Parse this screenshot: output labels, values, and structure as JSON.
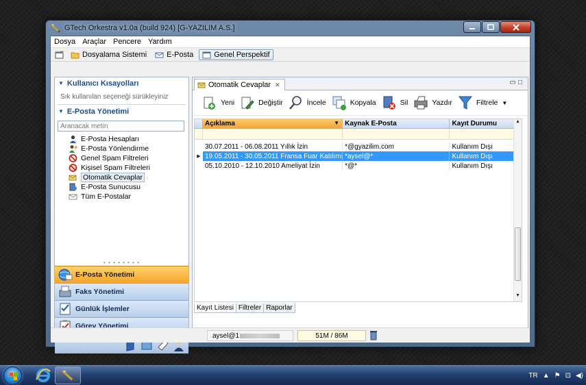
{
  "window": {
    "title": "GTech Orkestra v1.0a (build 924) [G-YAZILIM A.S.]"
  },
  "menubar": [
    "Dosya",
    "Araçlar",
    "Pencere",
    "Yardım"
  ],
  "perspectives": [
    "Dosyalama Sistemi",
    "E-Posta",
    "Genel Perspektif"
  ],
  "left": {
    "shortcuts_header": "Kullanıcı Kısayolları",
    "shortcuts_hint": "Sık kullanılan seçeneği sürükleyiniz",
    "email_header": "E-Posta Yönetimi",
    "search_placeholder": "Aranacak metin",
    "tree": [
      "E-Posta Hesapları",
      "E-Posta Yönlendirme",
      "Genel Spam Filtreleri",
      "Kişisel Spam Filtreleri",
      "Otomatik Cevaplar",
      "E-Posta Sunucusu",
      "Tüm E-Postalar"
    ],
    "selected_tree_item": "Otomatik Cevaplar",
    "nav_bars": [
      "E-Posta Yönetimi",
      "Faks Yönetimi",
      "Günlük İşlemler",
      "Görev Yönetimi"
    ]
  },
  "editor": {
    "tab_title": "Otomatik Cevaplar",
    "toolbar": [
      "Yeni",
      "Değiştir",
      "İncele",
      "Kopyala",
      "Sil",
      "Yazdır",
      "Filtrele"
    ],
    "columns": [
      "Açıklama",
      "Kaynak E-Posta",
      "Kayıt Durumu"
    ],
    "rows": [
      [
        "30.07.2011 - 06.08.2011 Yıllık İzin",
        "*@gyazilim.com",
        "Kullanım Dışı"
      ],
      [
        "19.05.2011 - 30.05.2011 Fransa Fuar Katılımı",
        "*aysel@*",
        "Kullanım Dışı"
      ],
      [
        "05.10.2010 - 12.10.2010 Ameliyat İzin",
        "*@*",
        "Kullanım Dışı"
      ]
    ],
    "selected_row": 1,
    "bottom_tabs": [
      "Kayıt Listesi",
      "Filtreler",
      "Raporlar"
    ]
  },
  "status": {
    "user": "aysel@1",
    "memory": "51M / 86M"
  },
  "taskbar": {
    "language": "TR"
  },
  "colors": {
    "accent": "#f7a52a",
    "selection": "#3399ff",
    "header": "#1d4d91"
  }
}
